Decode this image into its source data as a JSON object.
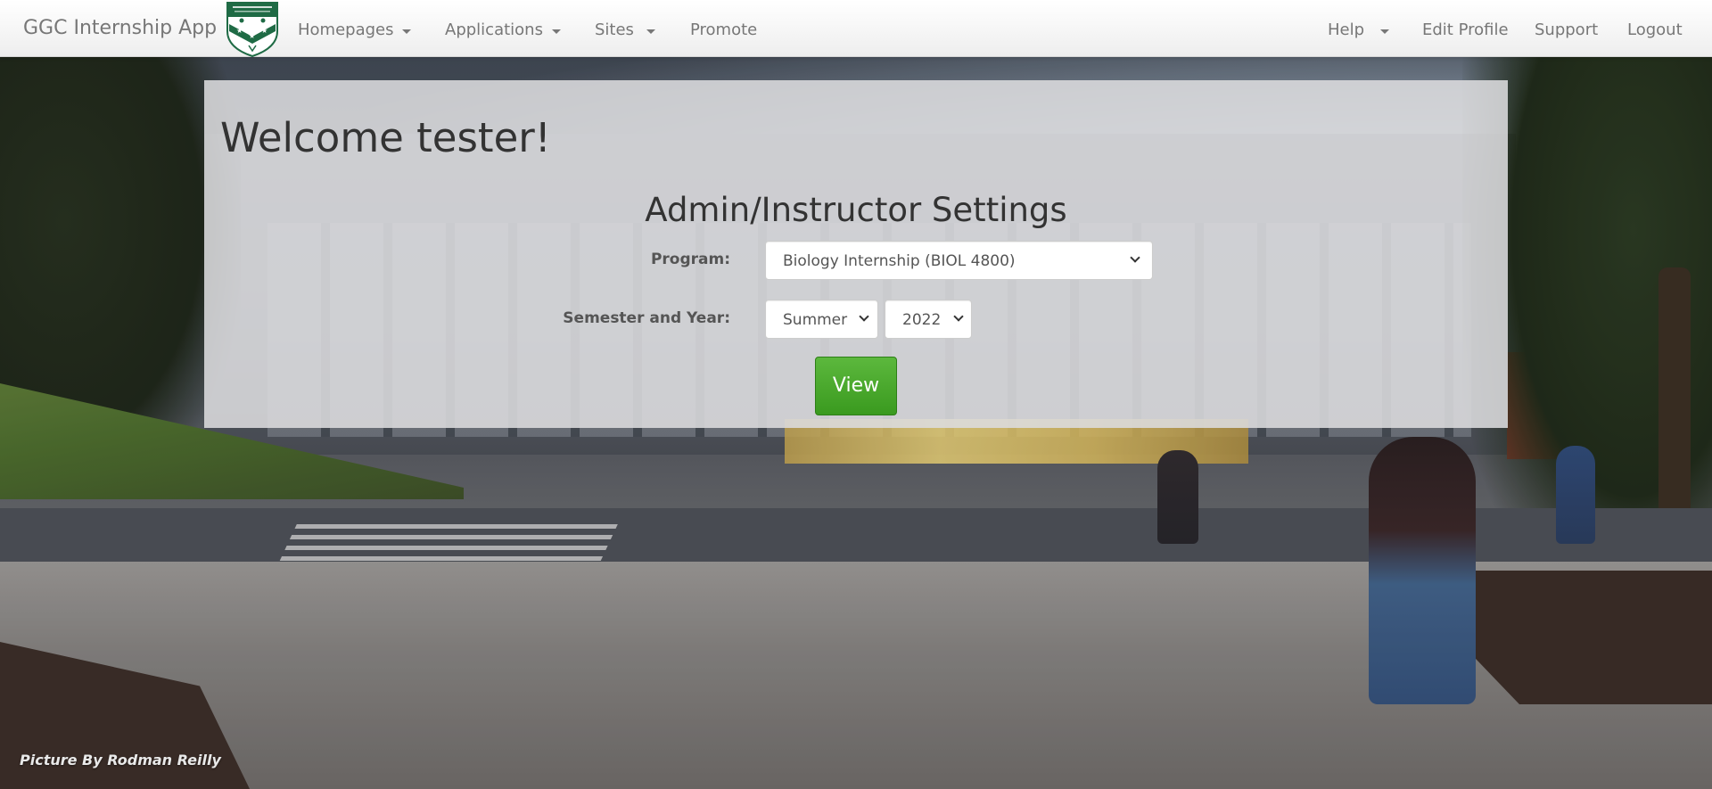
{
  "app": {
    "brand": "GGC Internship App"
  },
  "nav": {
    "left": [
      {
        "label": "Homepages",
        "dropdown": true
      },
      {
        "label": "Applications",
        "dropdown": true
      },
      {
        "label": "Sites",
        "dropdown": true
      },
      {
        "label": "Promote",
        "dropdown": false
      }
    ],
    "right": [
      {
        "label": "Help",
        "dropdown": true
      },
      {
        "label": "Edit Profile",
        "dropdown": false
      },
      {
        "label": "Support",
        "dropdown": false
      },
      {
        "label": "Logout",
        "dropdown": false
      }
    ]
  },
  "main": {
    "welcome": "Welcome tester!",
    "settings_title": "Admin/Instructor Settings",
    "program_label": "Program:",
    "program_value": "Biology Internship (BIOL 4800)",
    "semester_label": "Semester and Year:",
    "semester_value": "Summer",
    "year_value": "2022",
    "view_button": "View"
  },
  "background": {
    "credit": "Picture By Rodman Reilly"
  },
  "colors": {
    "accent_green": "#3a9a1f",
    "navbar_text": "#777777",
    "logo_green": "#1f6b45"
  }
}
